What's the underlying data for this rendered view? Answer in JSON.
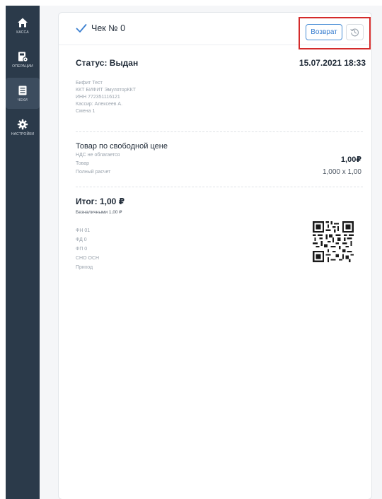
{
  "sidebar": {
    "items": [
      {
        "label": "КАССА",
        "icon": "home-icon",
        "active": false
      },
      {
        "label": "ОПЕРАЦИИ",
        "icon": "operations-icon",
        "active": false
      },
      {
        "label": "ЧЕКИ",
        "icon": "receipt-icon",
        "active": true
      },
      {
        "label": "НАСТРОЙКИ",
        "icon": "settings-icon",
        "active": false
      }
    ]
  },
  "receipt": {
    "title": "Чек № 0",
    "refund_label": "Возврат",
    "history_icon": "history-icon",
    "status": "Статус: Выдан",
    "datetime": "15.07.2021 18:33",
    "meta": [
      "Бифит Тест",
      "ККТ БИФИТ ЭмуляторККТ",
      "ИНН 772351116121",
      "Кассир: Алексеев А.",
      "Смена 1"
    ],
    "item": {
      "name": "Товар по свободной цене",
      "details": [
        "НДС не облагается",
        "Товар",
        "Полный расчет"
      ],
      "price": "1,00₽",
      "qty": "1,000 x 1,00"
    },
    "total": "Итог: 1,00 ₽",
    "payment": "Безналичными 1,00 ₽",
    "fiscal": [
      "ФН 01",
      "ФД 0",
      "ФП 0",
      "СНО ОСН",
      "Приход"
    ]
  },
  "colors": {
    "sidebar_bg": "#2b3a4a",
    "accent": "#3a7fd0",
    "check": "#3a7fd0",
    "highlight": "#d42b2b"
  }
}
